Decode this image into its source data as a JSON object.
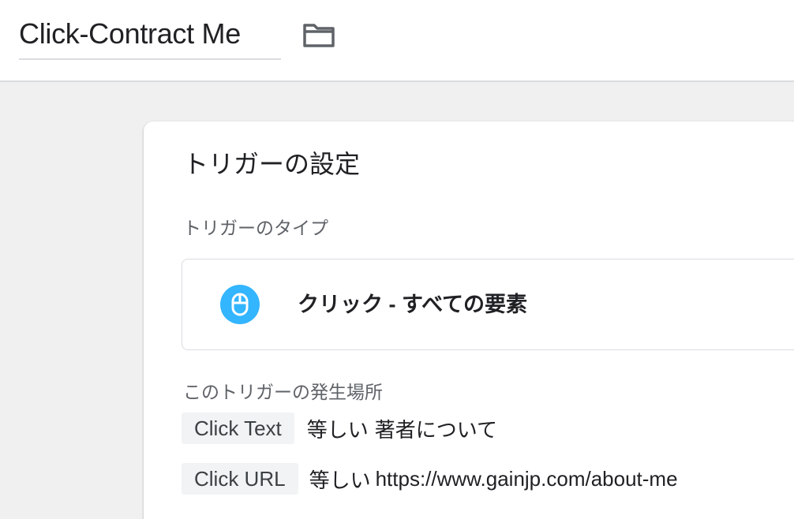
{
  "header": {
    "title": "Click-Contract Me",
    "folder_icon": "folder-icon"
  },
  "trigger": {
    "heading": "トリガーの設定",
    "type_label": "トリガーのタイプ",
    "type": {
      "icon": "mouse-icon",
      "icon_color": "#33b5ff",
      "name": "クリック - すべての要素"
    },
    "fires_label": "このトリガーの発生場所",
    "conditions": [
      {
        "variable": "Click Text",
        "operator": "等しい",
        "value": "著者について"
      },
      {
        "variable": "Click URL",
        "operator": "等しい",
        "value": "https://www.gainjp.com/about-me"
      }
    ]
  }
}
